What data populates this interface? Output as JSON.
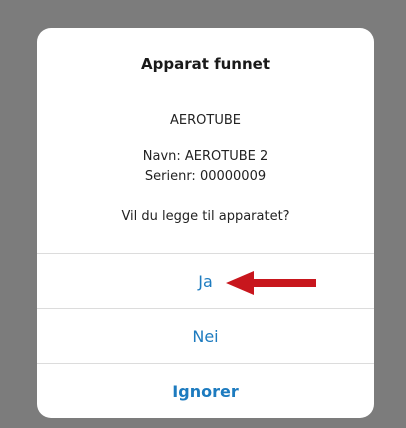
{
  "dialog": {
    "title": "Apparat funnet",
    "device_type": "AEROTUBE",
    "name_line": "Navn: AEROTUBE 2",
    "serial_line": "Serienr: 00000009",
    "question": "Vil du legge til apparatet?",
    "buttons": {
      "yes": "Ja",
      "no": "Nei",
      "ignore": "Ignorer"
    }
  },
  "colors": {
    "backdrop": "#7c7c7c",
    "button_text": "#1d7bbf",
    "arrow": "#c8161d"
  }
}
